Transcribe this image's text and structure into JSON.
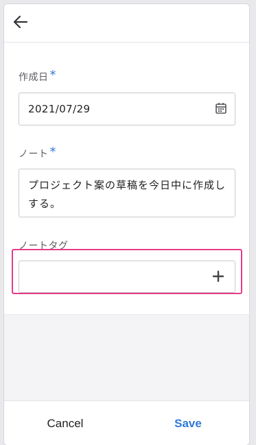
{
  "header": {
    "back_icon": "arrow-left-icon"
  },
  "form": {
    "created_date": {
      "label": "作成日",
      "required_mark": "*",
      "value": "2021/07/29",
      "icon": "calendar-icon"
    },
    "note": {
      "label": "ノート",
      "required_mark": "*",
      "value": "プロジェクト案の草稿を今日中に作成しする。"
    },
    "note_tag": {
      "label": "ノートタグ",
      "value": "",
      "add_icon": "plus-icon",
      "highlight_color": "#e83a86"
    }
  },
  "footer": {
    "cancel_label": "Cancel",
    "save_label": "Save"
  },
  "colors": {
    "accent": "#2f7ad8",
    "highlight": "#e83a86"
  }
}
